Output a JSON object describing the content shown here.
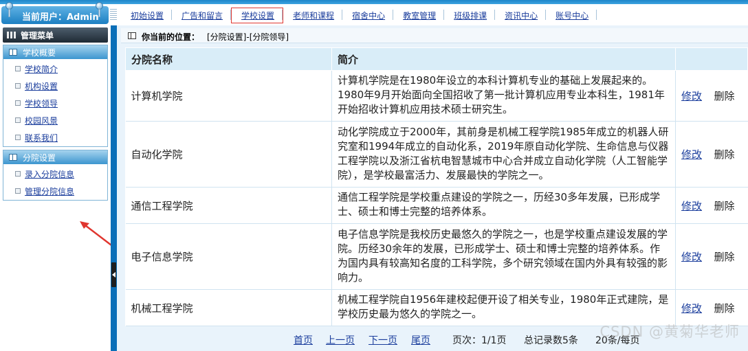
{
  "header": {
    "current_user": "当前用户：Admin",
    "nav": [
      {
        "label": "初始设置",
        "active": false
      },
      {
        "label": "广告和留言",
        "active": false
      },
      {
        "label": "学校设置",
        "active": true
      },
      {
        "label": "老师和课程",
        "active": false
      },
      {
        "label": "宿舍中心",
        "active": false
      },
      {
        "label": "教室管理",
        "active": false
      },
      {
        "label": "班级排课",
        "active": false
      },
      {
        "label": "资讯中心",
        "active": false
      },
      {
        "label": "账号中心",
        "active": false
      }
    ]
  },
  "sidebar": {
    "title": "管理菜单",
    "groups": [
      {
        "title": "学校概要",
        "items": [
          "学校简介",
          "机构设置",
          "学校领导",
          "校园风景",
          "联系我们"
        ]
      },
      {
        "title": "分院设置",
        "items": [
          "录入分院信息",
          "管理分院信息"
        ]
      }
    ]
  },
  "breadcrumb": {
    "label": "你当前的位置：",
    "path": "[分院设置]-[分院领导]"
  },
  "table": {
    "headers": [
      "分院名称",
      "简介",
      ""
    ],
    "edit_label": "修改",
    "delete_label": "删除",
    "rows": [
      {
        "name": "计算机学院",
        "intro": "计算机学院是在1980年设立的本科计算机专业的基础上发展起来的。1980年9月开始面向全国招收了第一批计算机应用专业本科生，1981年开始招收计算机应用技术硕士研究生。"
      },
      {
        "name": "自动化学院",
        "intro": "动化学院成立于2000年，其前身是机械工程学院1985年成立的机器人研究室和1994年成立的自动化系，2019年原自动化学院、生命信息与仪器工程学院以及浙江省杭电智慧城市中心合并成立自动化学院（人工智能学院），是学校最富活力、发展最快的学院之一。"
      },
      {
        "name": "通信工程学院",
        "intro": "通信工程学院是学校重点建设的学院之一，历经30多年发展，已形成学士、硕士和博士完整的培养体系。"
      },
      {
        "name": "电子信息学院",
        "intro": "电子信息学院是我校历史最悠久的学院之一，也是学校重点建设发展的学院。历经30余年的发展，已形成学士、硕士和博士完整的培养体系。作为国内具有较高知名度的工科学院，多个研究领域在国内外具有较强的影响力。"
      },
      {
        "name": "机械工程学院",
        "intro": "机械工程学院自1956年建校起便开设了相关专业，1980年正式建院，是学校历史最为悠久的学院之一。"
      }
    ]
  },
  "pager": {
    "first": "首页",
    "prev": "上一页",
    "next": "下一页",
    "last": "尾页",
    "page_info": "页次：1/1页",
    "total": "总记录数5条",
    "per_page": "20条/每页"
  },
  "watermark": "CSDN @黄菊华老师",
  "colors": {
    "accent": "#0a6fb8",
    "link": "#1a3d9c",
    "active_border": "#e0362f",
    "annotation_arrow": "#e0362f"
  }
}
